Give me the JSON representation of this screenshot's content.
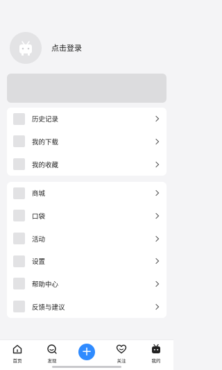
{
  "profile": {
    "login_text": "点击登录",
    "avatar_icon": "tv-mascot-icon"
  },
  "group1": [
    {
      "label": "历史记录",
      "icon": "history-icon"
    },
    {
      "label": "我的下载",
      "icon": "download-icon"
    },
    {
      "label": "我的收藏",
      "icon": "favorite-icon"
    }
  ],
  "group2": [
    {
      "label": "商城",
      "icon": "mall-icon"
    },
    {
      "label": "口袋",
      "icon": "pocket-icon"
    },
    {
      "label": "活动",
      "icon": "activity-icon"
    },
    {
      "label": "设置",
      "icon": "settings-icon"
    },
    {
      "label": "帮助中心",
      "icon": "help-icon"
    },
    {
      "label": "反馈与建议",
      "icon": "feedback-icon"
    }
  ],
  "tabbar": {
    "home": "首页",
    "discover": "发现",
    "add": "+",
    "follow": "关注",
    "mine": "我的"
  },
  "colors": {
    "accent": "#2f8bff",
    "background": "#f4f4f6"
  }
}
